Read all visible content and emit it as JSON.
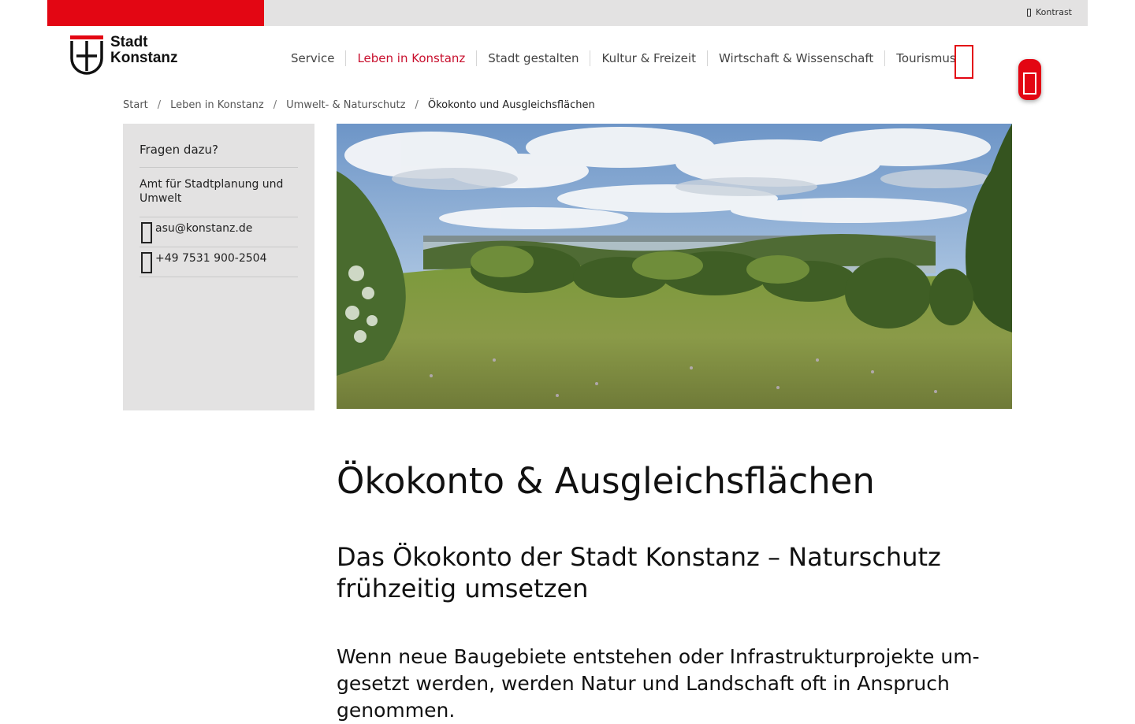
{
  "topbar": {
    "contrast_label": "Kontrast",
    "brand_color": "#e30613"
  },
  "logo": {
    "line1": "Stadt",
    "line2": "Konstanz"
  },
  "nav": {
    "items": [
      {
        "label": "Service",
        "active": false
      },
      {
        "label": "Leben in Konstanz",
        "active": true
      },
      {
        "label": "Stadt gestalten",
        "active": false
      },
      {
        "label": "Kultur & Freizeit",
        "active": false
      },
      {
        "label": "Wirtschaft & Wissenschaft",
        "active": false
      },
      {
        "label": "Tourismus",
        "active": false
      }
    ],
    "active_color": "#c8102e",
    "search_icon": "search-icon",
    "menu_icon": "menu-icon"
  },
  "breadcrumb": {
    "items": [
      "Start",
      "Leben in Konstanz",
      "Umwelt- & Naturschutz"
    ],
    "current": "Ökokonto und Ausgleichsflächen",
    "separator": "/"
  },
  "contact": {
    "heading": "Fragen dazu?",
    "org": "Amt für Stadtplanung und Umwelt",
    "email": "asu@konstanz.de",
    "phone": "+49 7531 900-2504",
    "email_icon": "mail-icon",
    "phone_icon": "phone-icon"
  },
  "hero": {
    "subject": "Wiese mit Bäumen und Blick auf den Bodensee"
  },
  "article": {
    "title": "Ökokonto & Ausgleichsflächen",
    "subtitle": "Das Ökokonto der Stadt Konstanz – Naturschutz frühzeitig umsetzen",
    "lead": "Wenn neue Baugebiete entstehen oder Infrastrukturprojekte um­gesetzt werden, werden Natur und Landschaft oft in Anspruch genommen."
  }
}
